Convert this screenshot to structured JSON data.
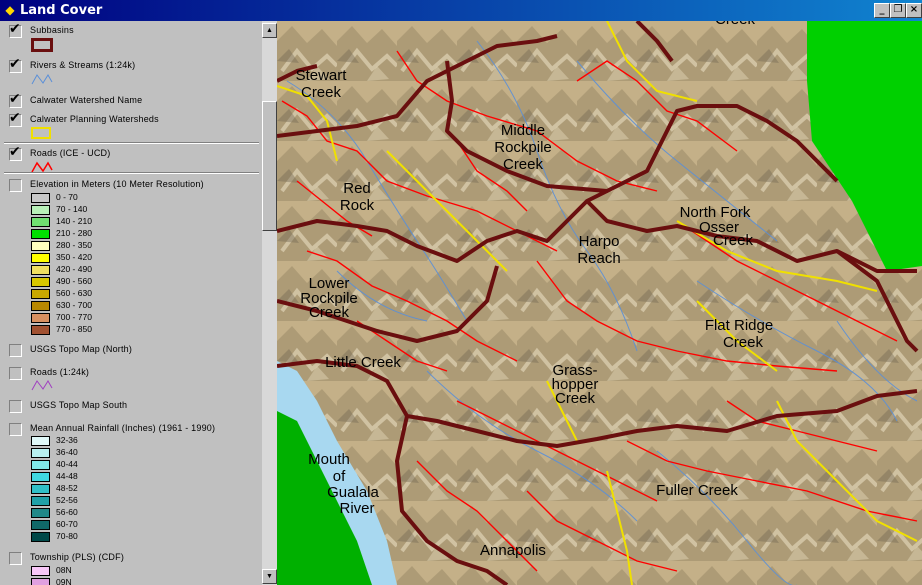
{
  "window": {
    "title": "Land Cover",
    "minimize": "_",
    "restore": "❐",
    "close": "×"
  },
  "legend": {
    "layers": [
      {
        "name": "Subbasins",
        "checked": true
      },
      {
        "name": "Rivers & Streams (1:24k)",
        "checked": true
      },
      {
        "name": "Calwater Watershed Name",
        "checked": true
      },
      {
        "name": "Calwater Planning Watersheds",
        "checked": true
      },
      {
        "name": "Roads (ICE - UCD)",
        "checked": true
      },
      {
        "name": "Elevation in Meters (10 Meter Resolution)",
        "checked": false
      },
      {
        "name": "USGS Topo Map (North)",
        "checked": false
      },
      {
        "name": "Roads (1:24k)",
        "checked": false
      },
      {
        "name": "USGS Topo Map South",
        "checked": false
      },
      {
        "name": "Mean Annual Rainfall (Inches) (1961 - 1990)",
        "checked": false
      },
      {
        "name": "Township (PLS) (CDF)",
        "checked": false
      }
    ],
    "elevation_classes": [
      {
        "label": "0 - 70",
        "color": "#c8c8c8"
      },
      {
        "label": "70 - 140",
        "color": "#b8f0b8"
      },
      {
        "label": "140 - 210",
        "color": "#70e070"
      },
      {
        "label": "210 - 280",
        "color": "#00e000"
      },
      {
        "label": "280 - 350",
        "color": "#ffffc0"
      },
      {
        "label": "350 - 420",
        "color": "#ffff00"
      },
      {
        "label": "420 - 490",
        "color": "#f0e060"
      },
      {
        "label": "490 - 560",
        "color": "#d8c800"
      },
      {
        "label": "560 - 630",
        "color": "#c8a800"
      },
      {
        "label": "630 - 700",
        "color": "#b88800"
      },
      {
        "label": "700 - 770",
        "color": "#d89060"
      },
      {
        "label": "770 - 850",
        "color": "#a05030"
      }
    ],
    "rainfall_classes": [
      {
        "label": "32-36",
        "color": "#e0f8f8"
      },
      {
        "label": "36-40",
        "color": "#b8f0f0"
      },
      {
        "label": "40-44",
        "color": "#80e8e8"
      },
      {
        "label": "44-48",
        "color": "#40d8e0"
      },
      {
        "label": "48-52",
        "color": "#30c0c8"
      },
      {
        "label": "52-56",
        "color": "#20a0a8"
      },
      {
        "label": "56-60",
        "color": "#208888"
      },
      {
        "label": "60-70",
        "color": "#106868"
      },
      {
        "label": "70-80",
        "color": "#004848"
      }
    ],
    "township_classes": [
      {
        "label": "08N",
        "color": "#f8c8f8"
      },
      {
        "label": "09N",
        "color": "#e0a0e0"
      }
    ]
  },
  "map": {
    "labels": [
      "Stewart Creek",
      "Middle Rockpile Creek",
      "Red Rock",
      "Harpo Reach",
      "North Fork Osser Creek",
      "Lower Rockpile Creek",
      "Little Creek",
      "Grass-hopper Creek",
      "Flat Ridge Creek",
      "Mouth of Gualala River",
      "Fuller Creek",
      "Annapolis",
      "Creek"
    ],
    "colors": {
      "subbasins": "#6a0f0f",
      "roads": "#ff0000",
      "streams": "#5a8fd8",
      "watersheds": "#f0e000",
      "ocean": "#00c000",
      "water": "#a8d8f0"
    }
  }
}
